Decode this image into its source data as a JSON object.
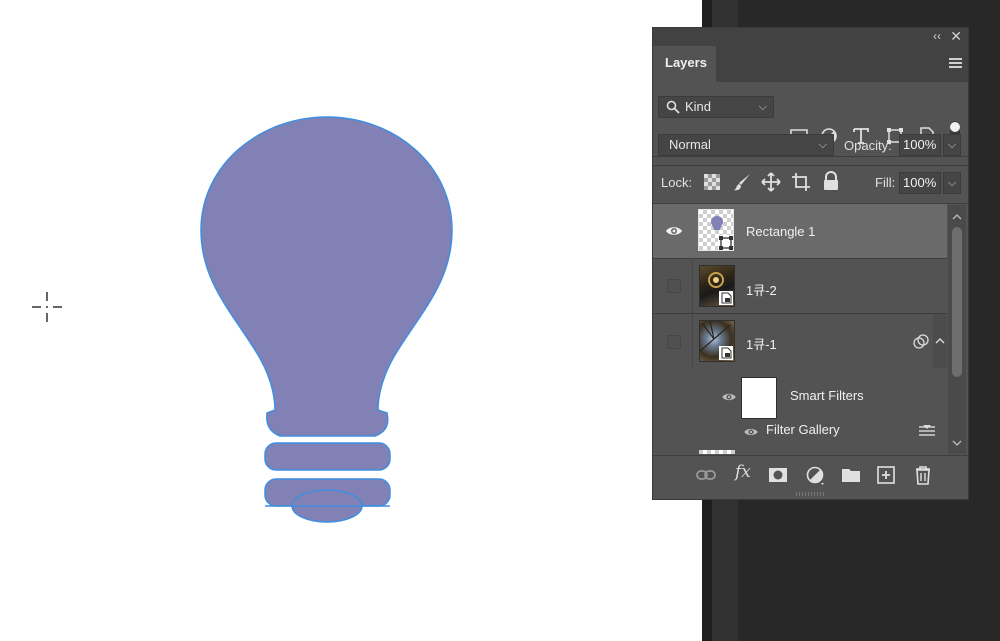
{
  "canvas": {
    "shape_fill": "#8281b5",
    "shape_outline": "#3f8fe0"
  },
  "layers_panel": {
    "tab_label": "Layers",
    "filter_kind_label": "Kind",
    "blend_mode": "Normal",
    "opacity_label": "Opacity:",
    "opacity_value": "100%",
    "lock_label": "Lock:",
    "fill_label": "Fill:",
    "fill_value": "100%",
    "layers": [
      {
        "name": "Rectangle 1",
        "visible": true,
        "selected": true,
        "thumb": "shape"
      },
      {
        "name": "1큐-2",
        "visible": false,
        "selected": false,
        "thumb": "smart-object"
      },
      {
        "name": "1큐-1",
        "visible": false,
        "selected": false,
        "thumb": "smart-object"
      }
    ],
    "smart_filters_label": "Smart Filters",
    "filter_gallery_label": "Filter Gallery",
    "filter_icons": [
      "image-filter-icon",
      "adjustment-filter-icon",
      "type-filter-icon",
      "shape-filter-icon",
      "smart-object-filter-icon",
      "filter-toggle-icon"
    ],
    "lock_icons": [
      "lock-transparent-pixels-icon",
      "lock-image-pixels-icon",
      "lock-position-icon",
      "lock-artboard-icon",
      "lock-all-icon"
    ],
    "bottom_icons": [
      "link-layers-icon",
      "fx-icon",
      "add-mask-icon",
      "adjustment-layer-icon",
      "group-folder-icon",
      "new-layer-icon",
      "delete-layer-icon"
    ],
    "fx_label": "fx"
  },
  "colors": {
    "panel_bg": "#535353",
    "selected_row": "#6a6a6a",
    "workspace": "#282828"
  }
}
